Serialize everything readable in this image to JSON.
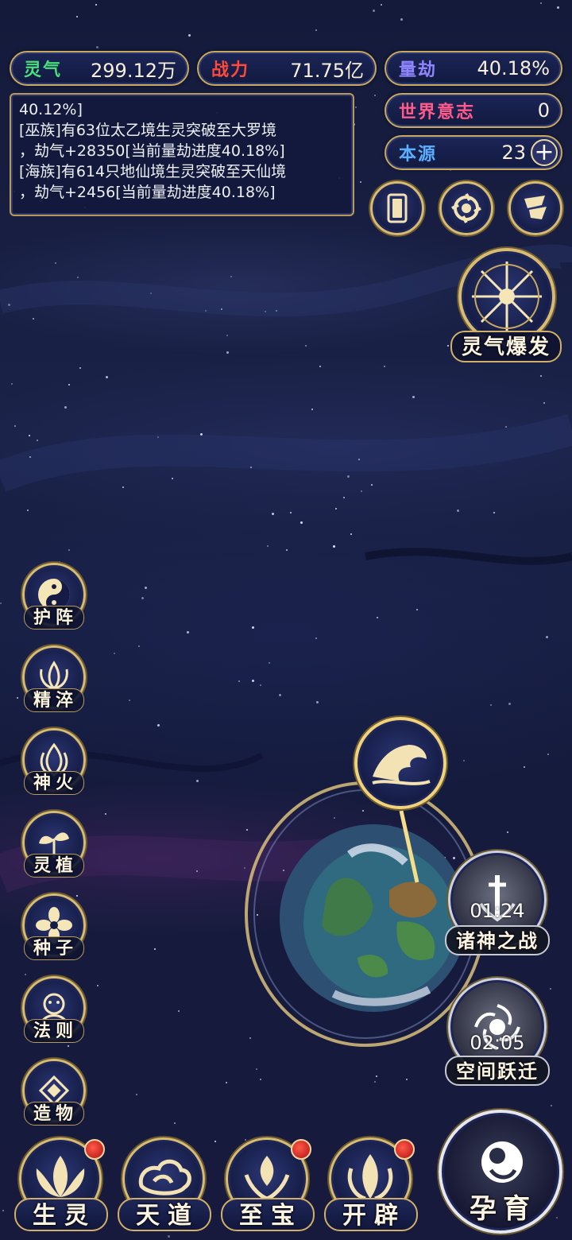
{
  "stats": {
    "lingqi": {
      "label": "灵气",
      "value": "299.12万",
      "color": "#48e07a"
    },
    "zhanli": {
      "label": "战力",
      "value": "71.75亿",
      "color": "#ff4a3a"
    },
    "liangjie": {
      "label": "量劫",
      "value": "40.18%",
      "color": "#8f86ff"
    },
    "shijie": {
      "label": "世界意志",
      "value": "0",
      "color": "#ff5a8a"
    },
    "benyuan": {
      "label": "本源",
      "value": "23",
      "color": "#5ab0ff"
    }
  },
  "log": {
    "lines": [
      "40.12%]",
      "[巫族]有63位太乙境生灵突破至大罗境",
      "，劫气+28350[当前量劫进度40.18%]",
      "[海族]有614只地仙境生灵突破至天仙境",
      "，劫气+2456[当前量劫进度40.18%]"
    ]
  },
  "top_icons": [
    {
      "name": "card-icon"
    },
    {
      "name": "vortex-icon"
    },
    {
      "name": "flag-icon"
    }
  ],
  "burst": {
    "label": "灵气爆发"
  },
  "side_menu": [
    {
      "label": "护阵",
      "icon": "yin-yang-icon"
    },
    {
      "label": "精淬",
      "icon": "lotus-icon"
    },
    {
      "label": "神火",
      "icon": "fire-icon"
    },
    {
      "label": "灵植",
      "icon": "plant-icon"
    },
    {
      "label": "种子",
      "icon": "seed-flower-icon"
    },
    {
      "label": "法则",
      "icon": "law-icon"
    },
    {
      "label": "造物",
      "icon": "creation-icon"
    }
  ],
  "world_marker": {
    "icon": "wave-icon"
  },
  "events": [
    {
      "label": "诸神之战",
      "time": "01:24",
      "icon": "sword-icon"
    },
    {
      "label": "空间跃迁",
      "time": "02:05",
      "icon": "portal-icon"
    }
  ],
  "bottom_nav": [
    {
      "label": "生灵",
      "icon": "lotus-nav-icon",
      "badge": true
    },
    {
      "label": "天道",
      "icon": "cloud-nav-icon",
      "badge": false
    },
    {
      "label": "至宝",
      "icon": "treasure-nav-icon",
      "badge": true
    },
    {
      "label": "开辟",
      "icon": "flame-nav-icon",
      "badge": true
    }
  ],
  "yunyu": {
    "label": "孕育",
    "icon": "embryo-icon"
  }
}
